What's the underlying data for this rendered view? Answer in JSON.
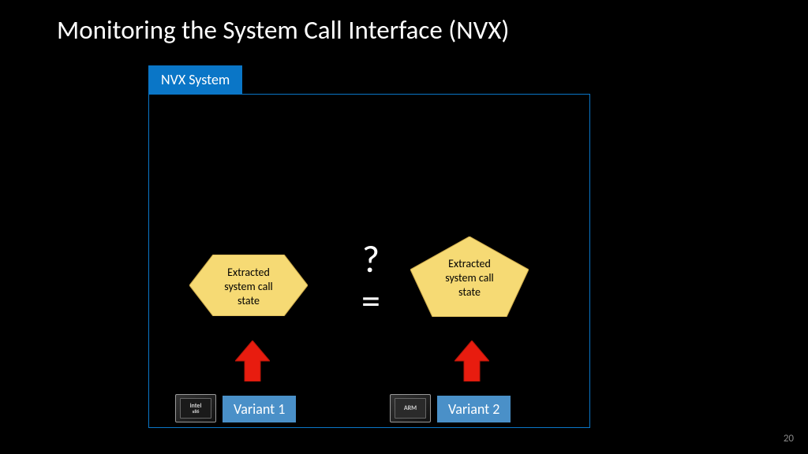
{
  "title": "Monitoring the System Call Interface (NVX)",
  "page_number": "20",
  "nvx_tab": "NVX System",
  "variant1": {
    "label": "Variant 1",
    "chip": "intel"
  },
  "variant2": {
    "label": "Variant 2",
    "chip": "ARM"
  },
  "state1": {
    "label": "Extracted\nsystem call\nstate"
  },
  "state2": {
    "label": "Extracted\nsystem call\nstate"
  },
  "comparator": {
    "q": "?",
    "eq": "="
  },
  "colors": {
    "accent": "#0a76c7",
    "shape_fill": "#f6da74",
    "arrow": "#e81c0f"
  }
}
